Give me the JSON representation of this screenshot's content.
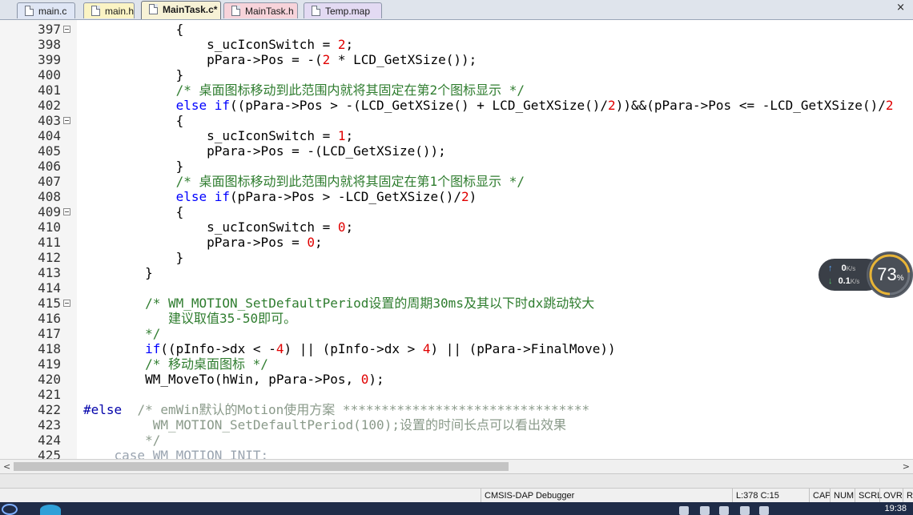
{
  "tabs": [
    {
      "label": "main.c",
      "bg": "#dfe6f5"
    },
    {
      "label": "main.h",
      "bg": "#fbf4c4"
    },
    {
      "label": "MainTask.c*",
      "bg": "#f7f2d6",
      "active": true
    },
    {
      "label": "MainTask.h",
      "bg": "#f7d3da"
    },
    {
      "label": "Temp.map",
      "bg": "#e3daf3"
    }
  ],
  "close_glyph": "×",
  "editor": {
    "line_numbers": [
      "397",
      "398",
      "399",
      "400",
      "401",
      "402",
      "403",
      "404",
      "405",
      "406",
      "407",
      "408",
      "409",
      "410",
      "411",
      "412",
      "413",
      "414",
      "415",
      "416",
      "417",
      "418",
      "419",
      "420",
      "421",
      "422",
      "423",
      "424",
      "425"
    ],
    "lines": [
      [
        [
          "            {",
          ""
        ]
      ],
      [
        [
          "                s_ucIconSwitch = ",
          ""
        ],
        [
          "2",
          "num"
        ],
        [
          ";",
          ""
        ]
      ],
      [
        [
          "                pPara->Pos = -(",
          ""
        ],
        [
          "2",
          "num"
        ],
        [
          " * LCD_GetXSize());",
          ""
        ]
      ],
      [
        [
          "            }",
          ""
        ]
      ],
      [
        [
          "            ",
          ""
        ],
        [
          "/* 桌面图标移动到此范围内就将其固定在第2个图标显示 */",
          "cmt"
        ]
      ],
      [
        [
          "            ",
          ""
        ],
        [
          "else if",
          "kw"
        ],
        [
          "((pPara->Pos > -(LCD_GetXSize() + LCD_GetXSize()/",
          ""
        ],
        [
          "2",
          "num"
        ],
        [
          "))&&(pPara->Pos <= -LCD_GetXSize()/",
          ""
        ],
        [
          "2",
          "num"
        ]
      ],
      [
        [
          "            {",
          ""
        ]
      ],
      [
        [
          "                s_ucIconSwitch = ",
          ""
        ],
        [
          "1",
          "num"
        ],
        [
          ";",
          ""
        ]
      ],
      [
        [
          "                pPara->Pos = -(LCD_GetXSize());",
          ""
        ]
      ],
      [
        [
          "            }",
          ""
        ]
      ],
      [
        [
          "            ",
          ""
        ],
        [
          "/* 桌面图标移动到此范围内就将其固定在第1个图标显示 */",
          "cmt"
        ]
      ],
      [
        [
          "            ",
          ""
        ],
        [
          "else if",
          "kw"
        ],
        [
          "(pPara->Pos > -LCD_GetXSize()/",
          ""
        ],
        [
          "2",
          "num"
        ],
        [
          ")",
          ""
        ]
      ],
      [
        [
          "            {",
          ""
        ]
      ],
      [
        [
          "                s_ucIconSwitch = ",
          ""
        ],
        [
          "0",
          "num"
        ],
        [
          ";",
          ""
        ]
      ],
      [
        [
          "                pPara->Pos = ",
          ""
        ],
        [
          "0",
          "num"
        ],
        [
          ";",
          ""
        ]
      ],
      [
        [
          "            }",
          ""
        ]
      ],
      [
        [
          "        }",
          ""
        ]
      ],
      [
        [
          "",
          ""
        ]
      ],
      [
        [
          "        ",
          ""
        ],
        [
          "/* WM_MOTION_SetDefaultPeriod设置的周期30ms及其以下时dx跳动较大",
          "cmt"
        ]
      ],
      [
        [
          "           ",
          ""
        ],
        [
          "建议取值35-50即可。",
          "cmt"
        ]
      ],
      [
        [
          "        ",
          ""
        ],
        [
          "*/",
          "cmt"
        ]
      ],
      [
        [
          "        ",
          ""
        ],
        [
          "if",
          "kw"
        ],
        [
          "((pInfo->dx < -",
          ""
        ],
        [
          "4",
          "num"
        ],
        [
          ") || (pInfo->dx > ",
          ""
        ],
        [
          "4",
          "num"
        ],
        [
          ") || (pPara->FinalMove))",
          ""
        ]
      ],
      [
        [
          "        ",
          ""
        ],
        [
          "/* 移动桌面图标 */",
          "cmt"
        ]
      ],
      [
        [
          "        WM_MoveTo(hWin, pPara->Pos, ",
          ""
        ],
        [
          "0",
          "num"
        ],
        [
          ");",
          ""
        ]
      ],
      [
        [
          "",
          ""
        ]
      ],
      [
        [
          "#else",
          "pp"
        ],
        [
          "  ",
          ""
        ],
        [
          "/* emWin默认的Motion使用方案 ********************************",
          "cmtg"
        ]
      ],
      [
        [
          "         ",
          ""
        ],
        [
          "WM_MOTION_SetDefaultPeriod(100);设置的时间长点可以看出效果",
          "cmtg"
        ]
      ],
      [
        [
          "        ",
          ""
        ],
        [
          "*/",
          "cmtg"
        ]
      ],
      [
        [
          "    ",
          ""
        ],
        [
          "case WM_MOTION_INIT:",
          "gray"
        ]
      ]
    ],
    "fold_markers": [
      0,
      6,
      12,
      18
    ]
  },
  "scroll": {
    "left_arrow": "<",
    "right_arrow": ">"
  },
  "status": {
    "debugger": "CMSIS-DAP Debugger",
    "position": "L:378 C:15",
    "cap": "CAP",
    "num": "NUM",
    "scrl": "SCRL",
    "ovr": "OVR",
    "rw": "R"
  },
  "net": {
    "up": "0",
    "up_unit": "K/s",
    "down": "0.1",
    "down_unit": "K/s",
    "cpu": "73",
    "cpu_unit": "%",
    "cpu_fraction": 0.73
  },
  "taskbar": {
    "clock": "19:38"
  }
}
